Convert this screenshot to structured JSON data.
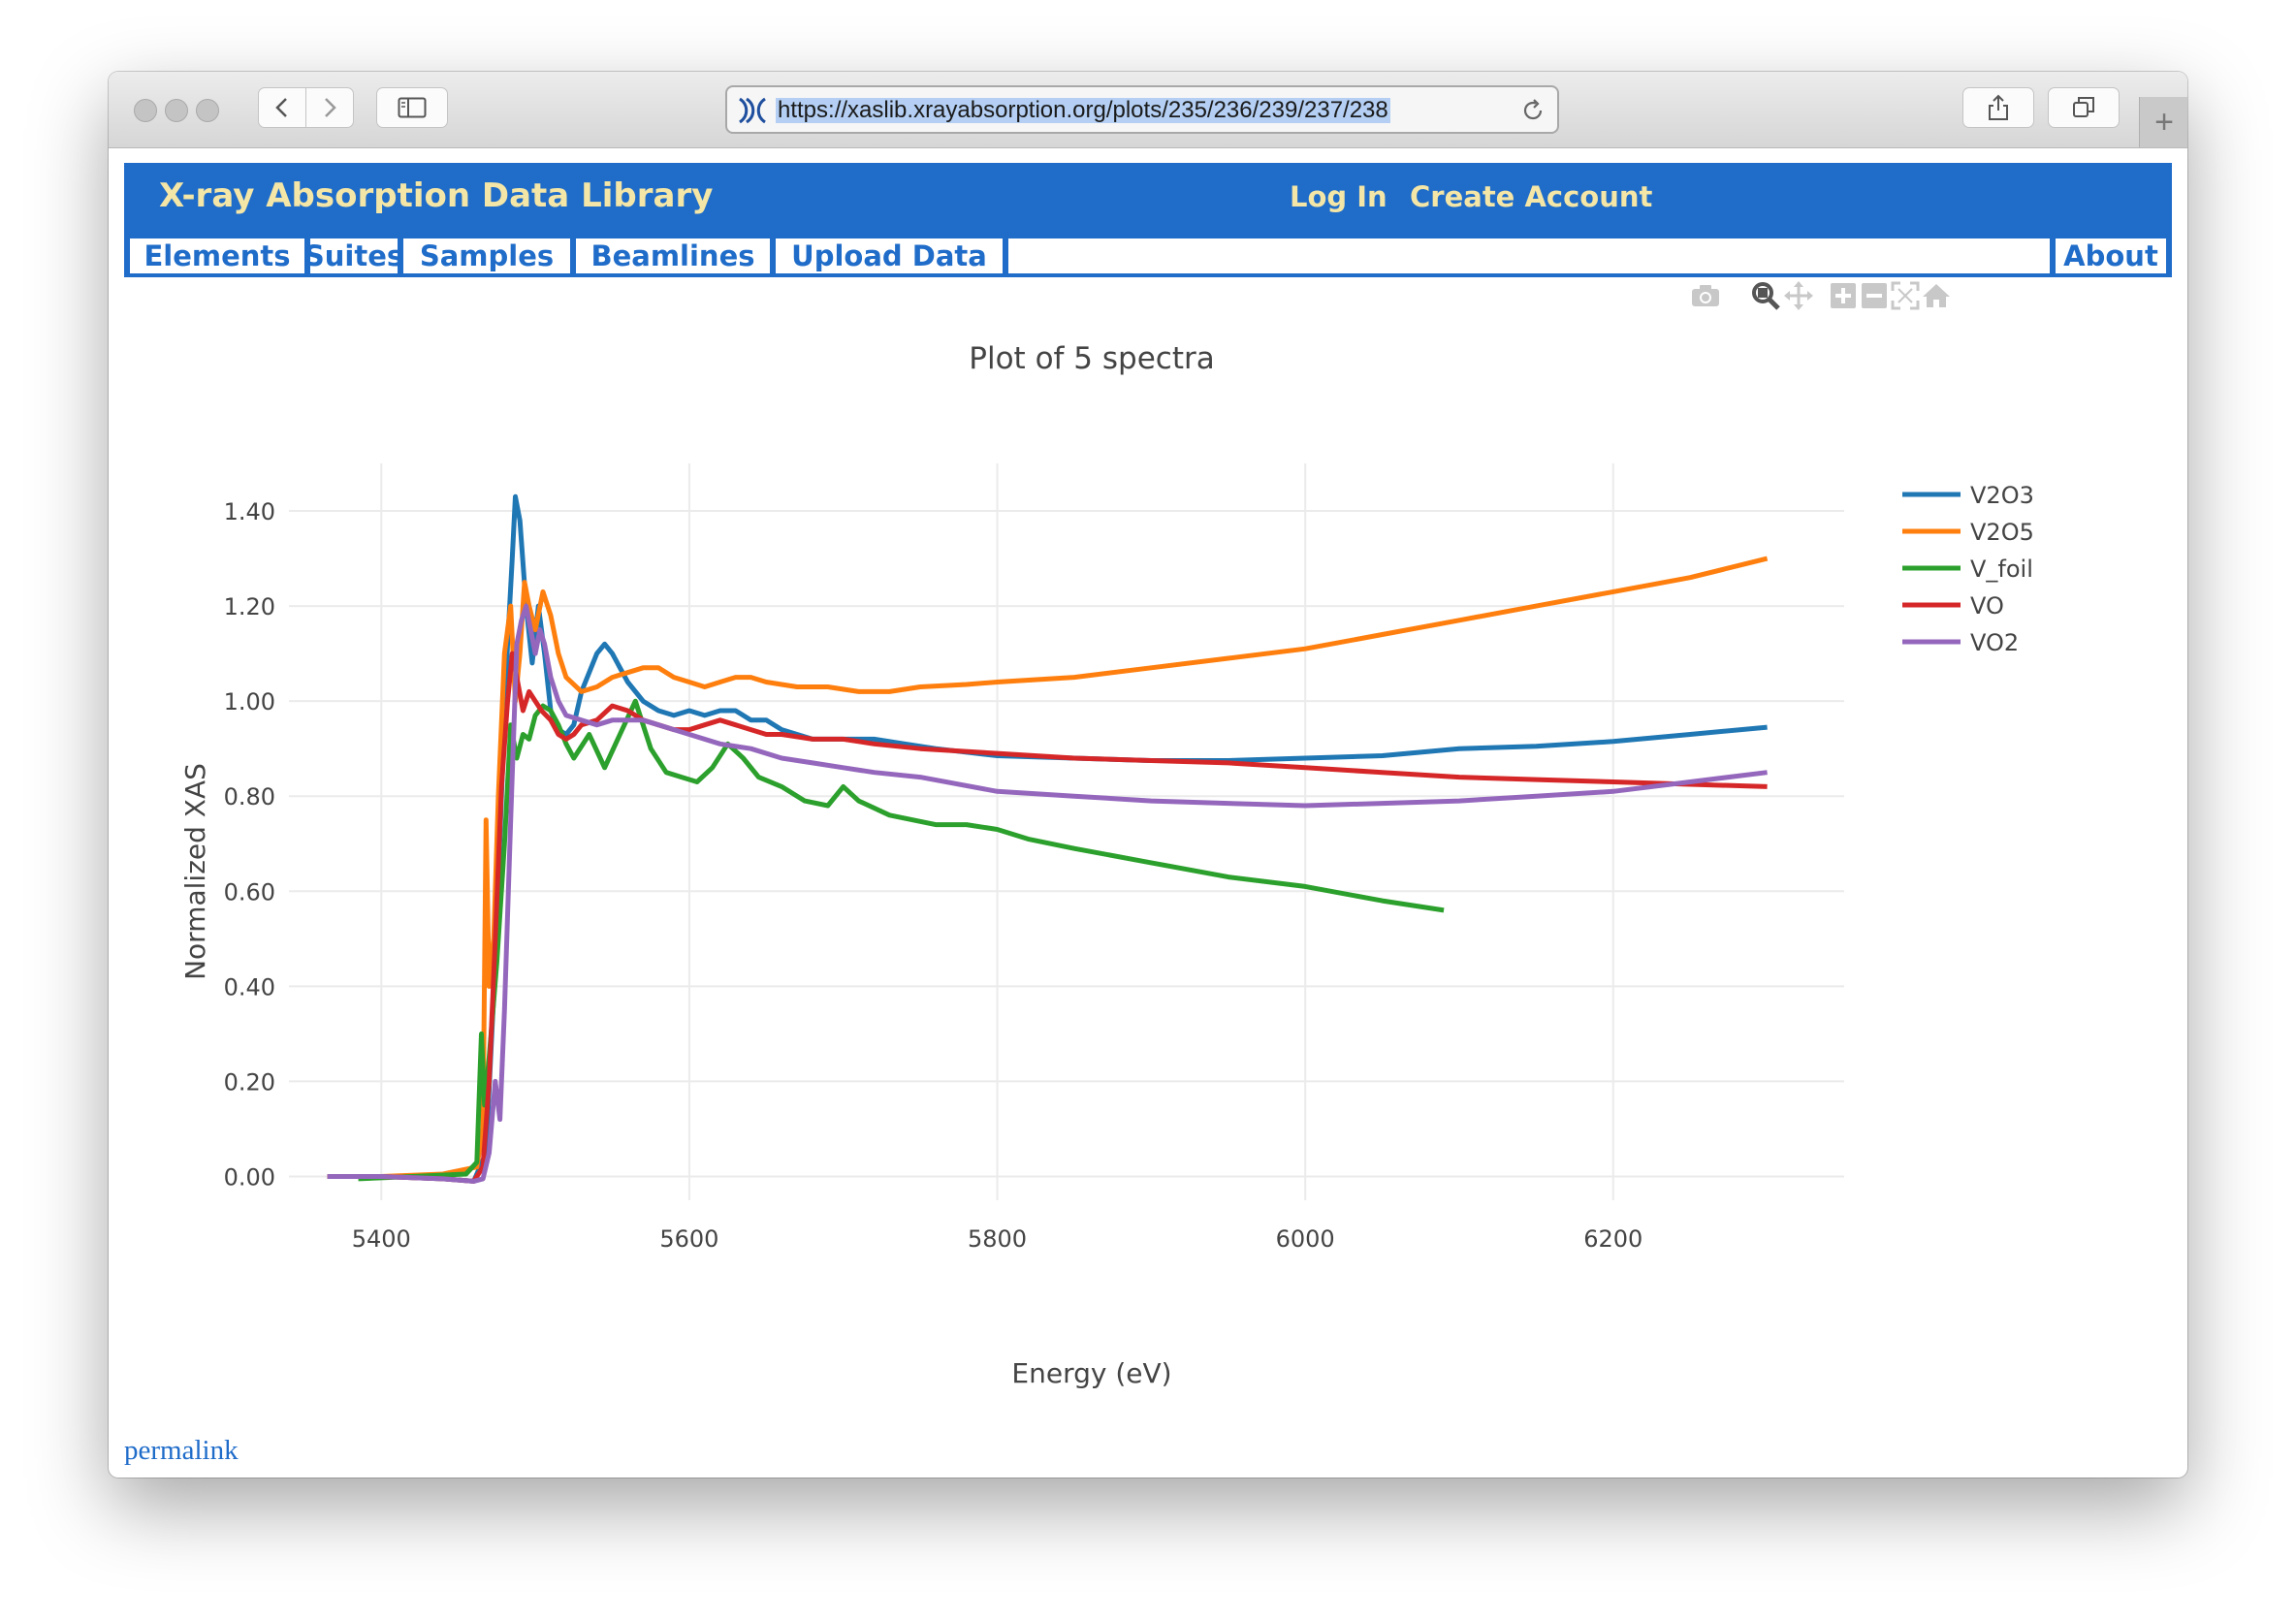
{
  "browser": {
    "url": "https://xaslib.xrayabsorption.org/plots/235/236/239/237/238",
    "new_tab": "+"
  },
  "site": {
    "title": "X-ray Absorption Data Library",
    "login": "Log In",
    "create_account": "Create Account",
    "nav": [
      "Elements",
      "Suites",
      "Samples",
      "Beamlines",
      "Upload Data"
    ],
    "about": "About",
    "permalink": "permalink"
  },
  "modebar_icons": [
    "camera-icon",
    "zoom-icon",
    "pan-icon",
    "zoom-in-icon",
    "zoom-out-icon",
    "autoscale-icon",
    "home-icon"
  ],
  "chart_data": {
    "type": "line",
    "title": "Plot of 5 spectra",
    "xlabel": "Energy (eV)",
    "ylabel": "Normalized XAS",
    "xlim": [
      5340,
      6350
    ],
    "ylim": [
      -0.05,
      1.5
    ],
    "xticks": [
      5400,
      5600,
      5800,
      6000,
      6200
    ],
    "yticks": [
      0.0,
      0.2,
      0.4,
      0.6,
      0.8,
      1.0,
      1.2,
      1.4
    ],
    "ytick_labels": [
      "0.00",
      "0.20",
      "0.40",
      "0.60",
      "0.80",
      "1.00",
      "1.20",
      "1.40"
    ],
    "grid": true,
    "legend_position": "top-right",
    "series": [
      {
        "name": "V2O3",
        "color": "#1f77b4",
        "x": [
          5365,
          5400,
          5440,
          5460,
          5468,
          5474,
          5478,
          5482,
          5485,
          5487,
          5490,
          5494,
          5498,
          5502,
          5506,
          5510,
          5515,
          5520,
          5525,
          5530,
          5540,
          5545,
          5550,
          5560,
          5570,
          5580,
          5590,
          5600,
          5610,
          5620,
          5630,
          5640,
          5650,
          5660,
          5680,
          5700,
          5720,
          5740,
          5760,
          5800,
          5850,
          5900,
          5950,
          6000,
          6050,
          6100,
          6150,
          6200,
          6250,
          6300
        ],
        "y": [
          0.0,
          0.0,
          -0.005,
          -0.01,
          0.05,
          0.45,
          0.8,
          1.12,
          1.3,
          1.43,
          1.38,
          1.2,
          1.08,
          1.2,
          1.1,
          0.98,
          0.94,
          0.93,
          0.95,
          1.02,
          1.1,
          1.12,
          1.1,
          1.04,
          1.0,
          0.98,
          0.97,
          0.98,
          0.97,
          0.98,
          0.98,
          0.96,
          0.96,
          0.94,
          0.92,
          0.92,
          0.92,
          0.91,
          0.9,
          0.885,
          0.88,
          0.875,
          0.875,
          0.88,
          0.885,
          0.9,
          0.905,
          0.915,
          0.93,
          0.945
        ]
      },
      {
        "name": "V2O5",
        "color": "#ff7f0e",
        "x": [
          5365,
          5400,
          5440,
          5462,
          5466,
          5468,
          5470,
          5473,
          5476,
          5480,
          5484,
          5487,
          5490,
          5493,
          5496,
          5500,
          5505,
          5510,
          5515,
          5520,
          5530,
          5540,
          5550,
          5560,
          5570,
          5580,
          5590,
          5600,
          5610,
          5620,
          5630,
          5640,
          5650,
          5670,
          5690,
          5710,
          5730,
          5750,
          5780,
          5800,
          5850,
          5900,
          5950,
          6000,
          6050,
          6100,
          6150,
          6200,
          6250,
          6300
        ],
        "y": [
          0.0,
          0.0,
          0.005,
          0.02,
          0.1,
          0.75,
          0.4,
          0.5,
          0.8,
          1.1,
          1.2,
          1.0,
          1.1,
          1.25,
          1.2,
          1.15,
          1.23,
          1.18,
          1.1,
          1.05,
          1.02,
          1.03,
          1.05,
          1.06,
          1.07,
          1.07,
          1.05,
          1.04,
          1.03,
          1.04,
          1.05,
          1.05,
          1.04,
          1.03,
          1.03,
          1.02,
          1.02,
          1.03,
          1.035,
          1.04,
          1.05,
          1.07,
          1.09,
          1.11,
          1.14,
          1.17,
          1.2,
          1.23,
          1.26,
          1.3
        ]
      },
      {
        "name": "V_foil",
        "color": "#2ca02c",
        "x": [
          5385,
          5420,
          5455,
          5462,
          5465,
          5467,
          5470,
          5475,
          5480,
          5484,
          5488,
          5492,
          5496,
          5500,
          5505,
          5510,
          5515,
          5520,
          5525,
          5535,
          5545,
          5555,
          5565,
          5575,
          5585,
          5595,
          5605,
          5615,
          5625,
          5635,
          5645,
          5660,
          5675,
          5690,
          5700,
          5710,
          5730,
          5760,
          5780,
          5800,
          5820,
          5850,
          5900,
          5950,
          6000,
          6050,
          6090
        ],
        "y": [
          -0.005,
          0.0,
          0.005,
          0.03,
          0.3,
          0.15,
          0.25,
          0.45,
          0.7,
          0.95,
          0.88,
          0.93,
          0.92,
          0.97,
          0.99,
          0.98,
          0.95,
          0.91,
          0.88,
          0.93,
          0.86,
          0.93,
          1.0,
          0.9,
          0.85,
          0.84,
          0.83,
          0.86,
          0.91,
          0.88,
          0.84,
          0.82,
          0.79,
          0.78,
          0.82,
          0.79,
          0.76,
          0.74,
          0.74,
          0.73,
          0.71,
          0.69,
          0.66,
          0.63,
          0.61,
          0.58,
          0.56
        ]
      },
      {
        "name": "VO",
        "color": "#d62728",
        "x": [
          5365,
          5400,
          5440,
          5460,
          5466,
          5470,
          5474,
          5478,
          5482,
          5485,
          5488,
          5492,
          5496,
          5500,
          5504,
          5510,
          5515,
          5520,
          5525,
          5530,
          5540,
          5550,
          5560,
          5570,
          5580,
          5590,
          5600,
          5610,
          5620,
          5630,
          5640,
          5650,
          5660,
          5680,
          5700,
          5720,
          5750,
          5800,
          5850,
          5900,
          5950,
          6000,
          6050,
          6100,
          6150,
          6200,
          6250,
          6300
        ],
        "y": [
          0.0,
          0.0,
          -0.005,
          -0.01,
          0.02,
          0.2,
          0.5,
          0.82,
          1.0,
          1.1,
          1.05,
          0.98,
          1.02,
          1.0,
          0.98,
          0.96,
          0.93,
          0.92,
          0.93,
          0.95,
          0.96,
          0.99,
          0.98,
          0.96,
          0.95,
          0.94,
          0.94,
          0.95,
          0.96,
          0.95,
          0.94,
          0.93,
          0.93,
          0.92,
          0.92,
          0.91,
          0.9,
          0.89,
          0.88,
          0.875,
          0.87,
          0.86,
          0.85,
          0.84,
          0.835,
          0.83,
          0.825,
          0.82
        ]
      },
      {
        "name": "VO2",
        "color": "#9467bd",
        "x": [
          5365,
          5400,
          5440,
          5460,
          5466,
          5470,
          5474,
          5477,
          5480,
          5484,
          5488,
          5491,
          5494,
          5497,
          5500,
          5503,
          5506,
          5510,
          5515,
          5520,
          5530,
          5540,
          5550,
          5560,
          5570,
          5580,
          5590,
          5600,
          5620,
          5640,
          5660,
          5680,
          5700,
          5720,
          5750,
          5800,
          5850,
          5900,
          5950,
          6000,
          6050,
          6100,
          6150,
          6200,
          6250,
          6300
        ],
        "y": [
          0.0,
          0.0,
          -0.005,
          -0.01,
          -0.005,
          0.05,
          0.2,
          0.12,
          0.35,
          0.75,
          1.12,
          1.17,
          1.2,
          1.15,
          1.1,
          1.15,
          1.12,
          1.05,
          1.0,
          0.97,
          0.96,
          0.95,
          0.96,
          0.96,
          0.96,
          0.95,
          0.94,
          0.93,
          0.91,
          0.9,
          0.88,
          0.87,
          0.86,
          0.85,
          0.84,
          0.81,
          0.8,
          0.79,
          0.785,
          0.78,
          0.785,
          0.79,
          0.8,
          0.81,
          0.83,
          0.85
        ]
      }
    ]
  }
}
